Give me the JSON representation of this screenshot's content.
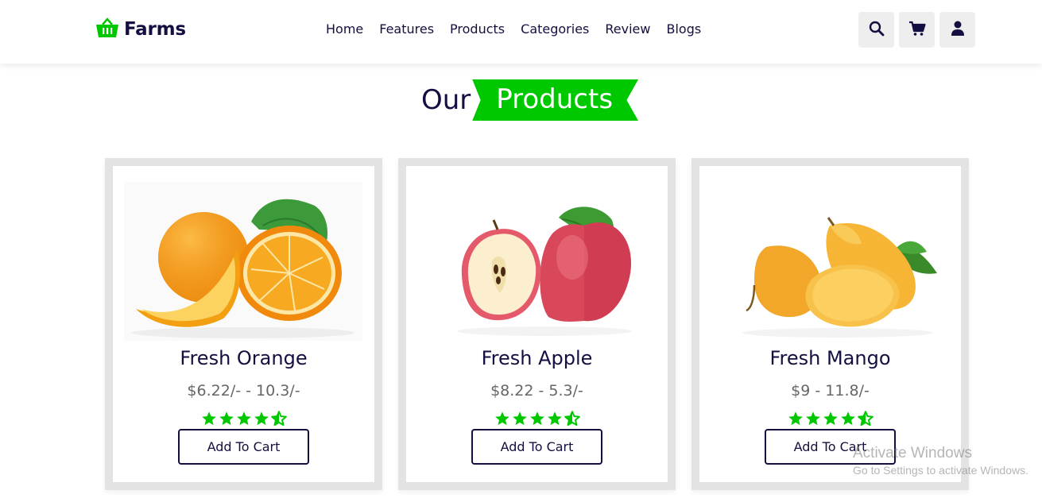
{
  "header": {
    "logo_text": "Farms",
    "nav": [
      "Home",
      "Features",
      "Products",
      "Categories",
      "Review",
      "Blogs"
    ],
    "icons": [
      "search-icon",
      "cart-icon",
      "user-icon"
    ]
  },
  "heading": {
    "prefix": "Our",
    "highlight": "Products"
  },
  "colors": {
    "accent": "#00c800",
    "text": "#130f40",
    "card_border": "#e3e3e3"
  },
  "products": [
    {
      "name": "Fresh Orange",
      "price": "$6.22/- - 10.3/-",
      "rating": 4.5,
      "button": "Add To Cart"
    },
    {
      "name": "Fresh Apple",
      "price": "$8.22 - 5.3/-",
      "rating": 4.5,
      "button": "Add To Cart"
    },
    {
      "name": "Fresh Mango",
      "price": "$9 - 11.8/-",
      "rating": 4.5,
      "button": "Add To Cart"
    }
  ],
  "os_watermark": {
    "title": "Activate Windows",
    "subtitle": "Go to Settings to activate Windows."
  }
}
